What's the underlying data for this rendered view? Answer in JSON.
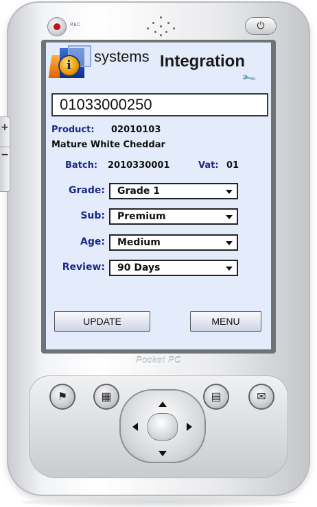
{
  "device": {
    "rec_label": "REC",
    "footer_brand": "Pocket PC"
  },
  "app": {
    "brand_part1": "systems",
    "brand_part2": "Integration",
    "barcode_value": "01033000250",
    "product_label": "Product:",
    "product_code": "02010103",
    "product_name": "Mature White Cheddar",
    "batch_label": "Batch:",
    "batch_value": "2010330001",
    "vat_label": "Vat:",
    "vat_value": "01",
    "fields": [
      {
        "label": "Grade:",
        "value": "Grade 1"
      },
      {
        "label": "Sub:",
        "value": "Premium"
      },
      {
        "label": "Age:",
        "value": "Medium"
      },
      {
        "label": "Review:",
        "value": "90 Days"
      }
    ],
    "buttons": {
      "update": "UPDATE",
      "menu": "MENU"
    }
  },
  "icons": {
    "logo": "systems-integration-logo",
    "settings": "wrench-icon",
    "power": "power-icon",
    "start": "windows-flag-icon",
    "calendar": "calendar-icon",
    "contacts": "contacts-icon",
    "inbox": "envelope-icon"
  },
  "colors": {
    "screen_bg": "#e4ecfb",
    "label_blue": "#1a2a8a",
    "rec_red": "#c0121c"
  }
}
